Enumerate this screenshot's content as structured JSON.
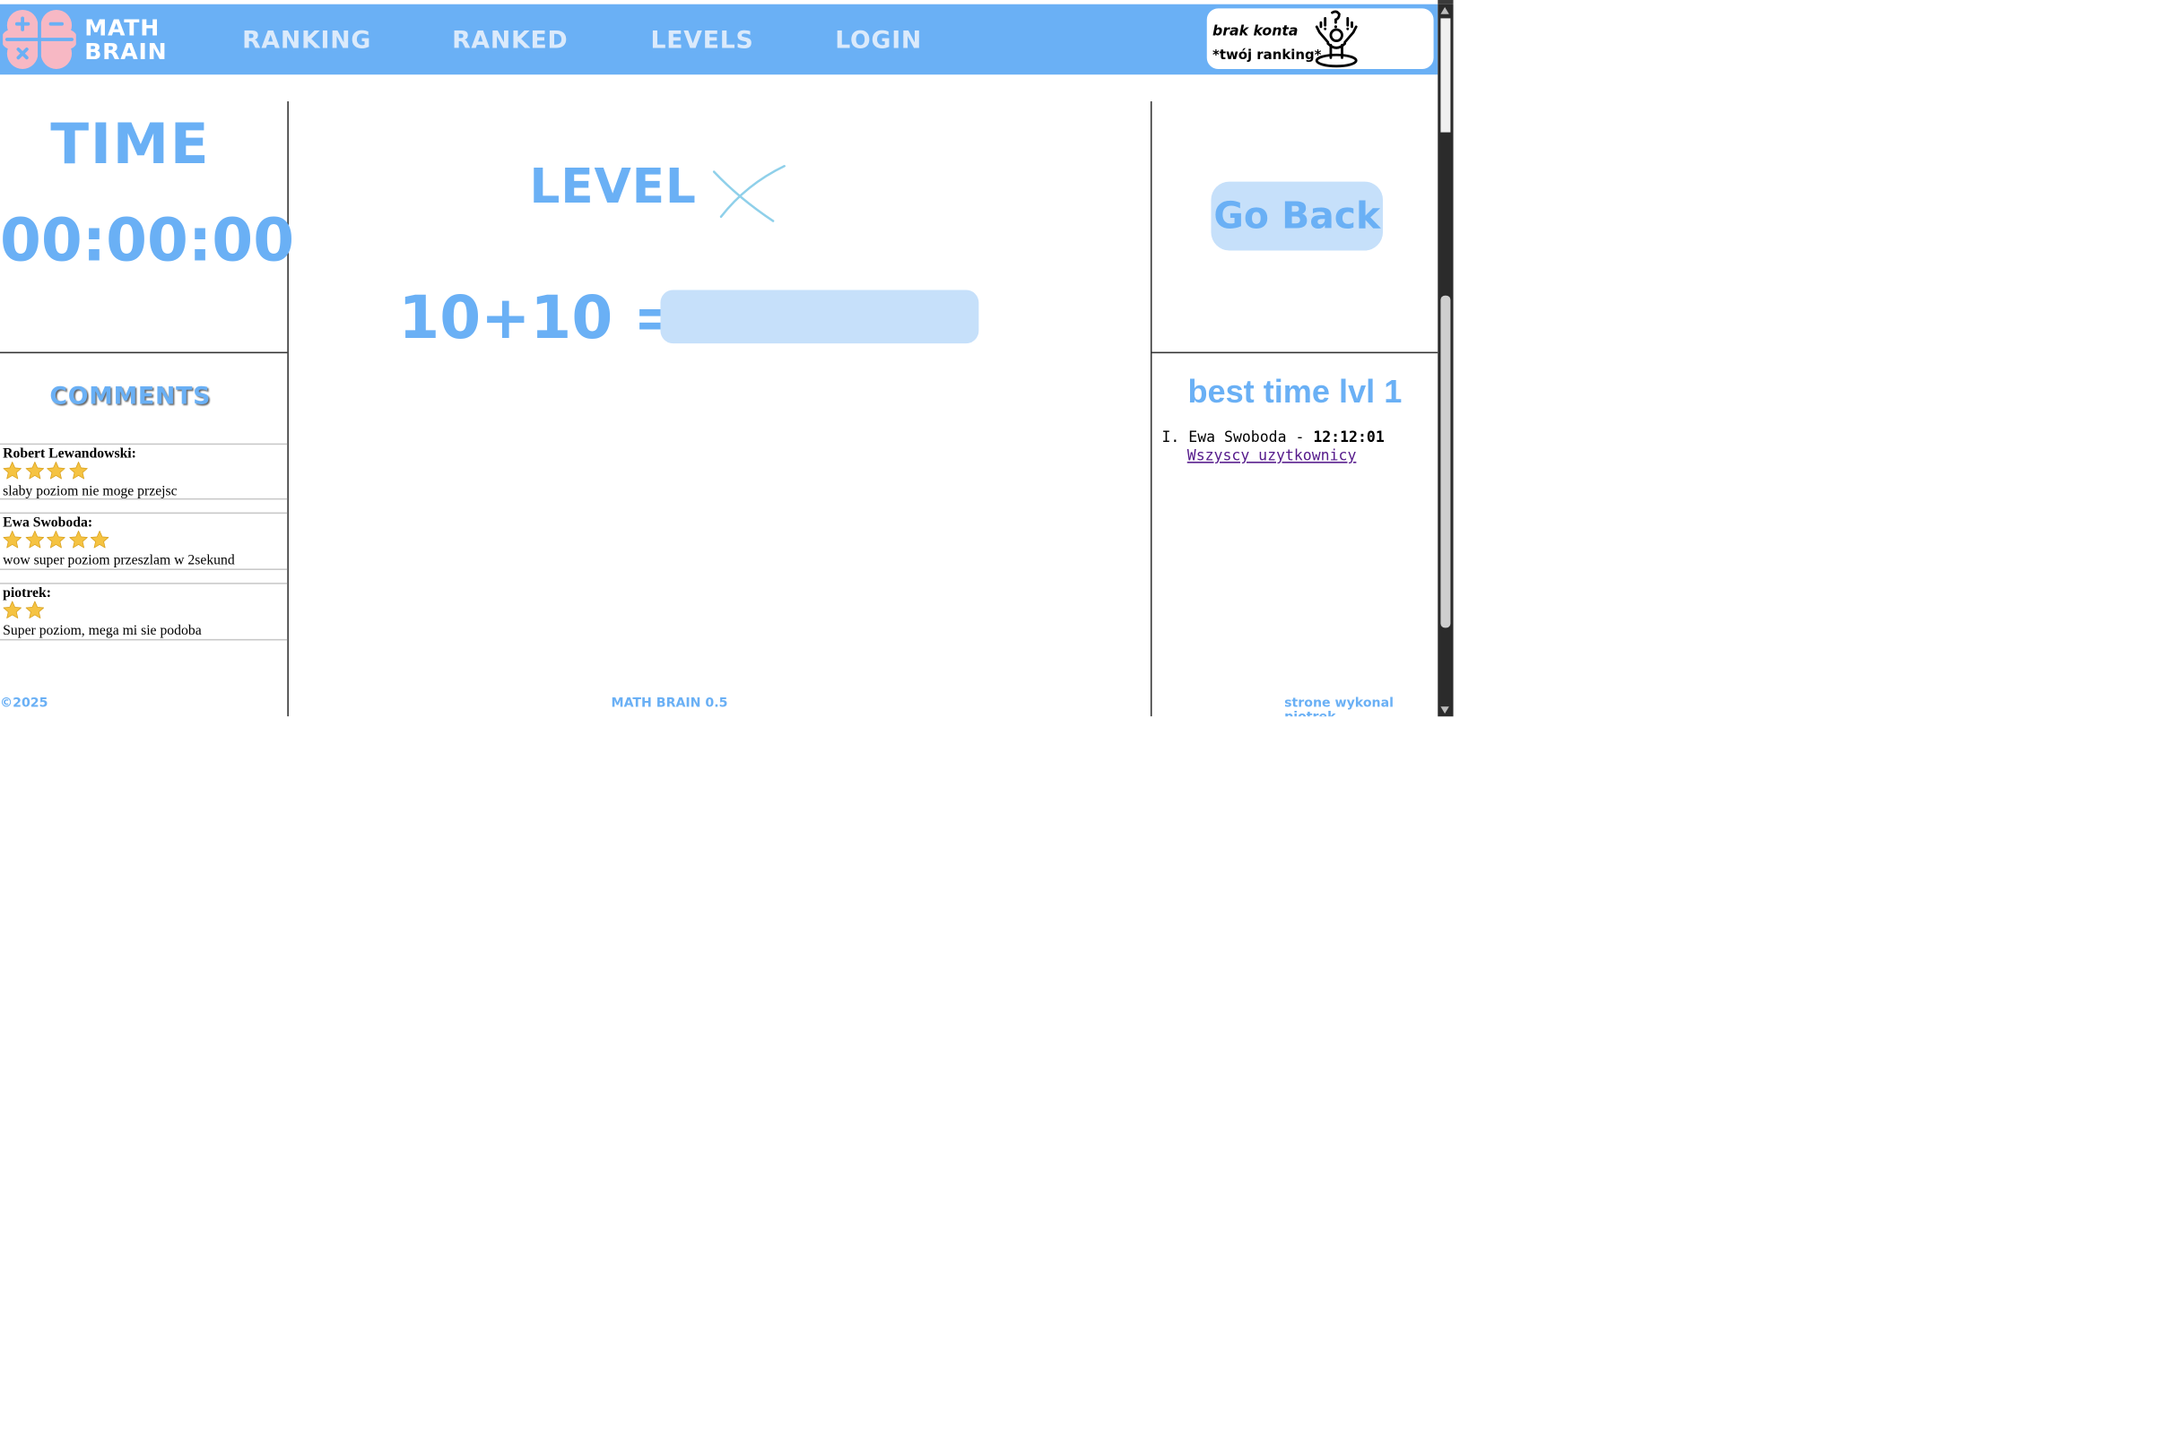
{
  "logo": {
    "line1": "MATH",
    "line2": "BRAIN"
  },
  "nav": [
    {
      "label": "RANKING"
    },
    {
      "label": "RANKED"
    },
    {
      "label": "LEVELS"
    },
    {
      "label": "LOGIN"
    }
  ],
  "account": {
    "line1": "brak konta",
    "line2": "*twój ranking*",
    "icon": "confused-person-icon"
  },
  "timer": {
    "title": "TIME",
    "value": "00:00:00"
  },
  "comments": {
    "title": "COMMENTS",
    "items": [
      {
        "author": "Robert Lewandowski:",
        "stars": 4,
        "text": "slaby poziom nie moge przejsc"
      },
      {
        "author": "Ewa Swoboda:",
        "stars": 5,
        "text": "wow super poziom przeszlam w 2sekund"
      },
      {
        "author": "piotrek:",
        "stars": 2,
        "text": "Super poziom, mega mi sie podoba"
      }
    ]
  },
  "level": {
    "label": "LEVEL",
    "mark_icon": "x-mark-icon"
  },
  "question": {
    "equation": "10+10 =",
    "answer_value": "",
    "answer_placeholder": ""
  },
  "actions": {
    "go_back": "Go Back"
  },
  "best_time": {
    "title": "best time lvl 1",
    "entries": [
      {
        "rank": "I.",
        "name": "Ewa Swoboda",
        "separator": "-",
        "time": "12:12:01"
      }
    ],
    "all_users_link": "Wszyscy uzytkownicy"
  },
  "footer": {
    "left": "©2025",
    "center": "MATH BRAIN 0.5",
    "right": "strone wykonal piotrek"
  },
  "colors": {
    "primary": "#6ab0f5",
    "light": "#c6e0fa",
    "brain": "#f7b8c4",
    "star": "#f5c342"
  }
}
